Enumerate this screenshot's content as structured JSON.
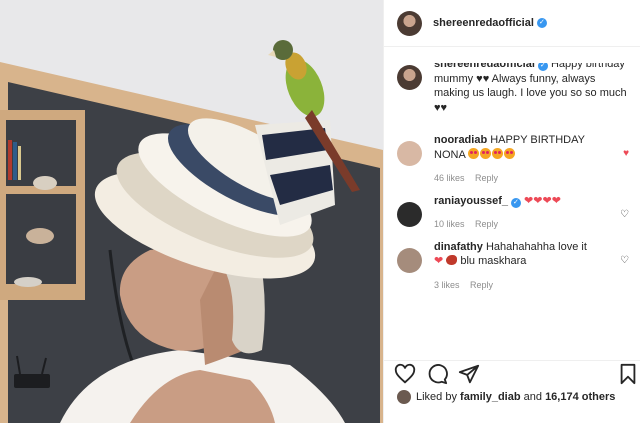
{
  "post": {
    "author": "shereenredaofficial",
    "caption": "Happy birthday mummy ♥♥ Always funny, always making us laugh. I love you so so much ♥♥"
  },
  "comments": [
    {
      "user": "nooradiab",
      "text": "HAPPY BIRTHDAY NONA",
      "likes": "46 likes",
      "reply": "Reply",
      "liked": true
    },
    {
      "user": "raniayoussef_",
      "text": "❤❤❤❤",
      "likes": "10 likes",
      "reply": "Reply",
      "liked": false
    },
    {
      "user": "dinafathy",
      "text": "Hahahahahha love it",
      "text2": "blu maskhara",
      "likes": "3 likes",
      "reply": "Reply",
      "liked": false
    }
  ],
  "likes_line": {
    "prefix": "Liked by",
    "user": "family_diab",
    "joiner": "and",
    "others": "16,174 others"
  },
  "icons": {
    "like": "heart-outline-icon",
    "comment": "speech-bubble-icon",
    "share": "paper-plane-icon",
    "save": "bookmark-icon",
    "verified": "verified-badge-icon"
  },
  "colors": {
    "verified": "#3897f0",
    "liked_heart": "#ed4956",
    "muted_text": "#8e8e8e"
  }
}
